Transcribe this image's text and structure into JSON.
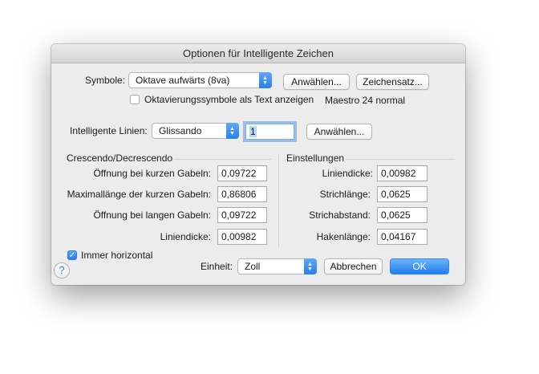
{
  "window": {
    "title": "Optionen für Intelligente Zeichen"
  },
  "symbole": {
    "label": "Symbole:",
    "selected": "Oktave aufwärts (8va)",
    "anwaehlen": "Anwählen...",
    "zeichensatz": "Zeichensatz...",
    "checkbox_label": "Oktavierungssymbole als Text anzeigen",
    "font_info": "Maestro 24 normal"
  },
  "linien": {
    "label": "Intelligente Linien:",
    "selected": "Glissando",
    "value": "1",
    "anwaehlen": "Anwählen..."
  },
  "crescendo": {
    "title": "Crescendo/Decrescendo",
    "rows": [
      {
        "label": "Öffnung bei kurzen Gabeln:",
        "value": "0,09722"
      },
      {
        "label": "Maximallänge der kurzen Gabeln:",
        "value": "0,86806"
      },
      {
        "label": "Öffnung bei langen Gabeln:",
        "value": "0,09722"
      },
      {
        "label": "Liniendicke:",
        "value": "0,00982"
      }
    ]
  },
  "einstellungen": {
    "title": "Einstellungen",
    "rows": [
      {
        "label": "Liniendicke:",
        "value": "0,00982"
      },
      {
        "label": "Strichlänge:",
        "value": "0,0625"
      },
      {
        "label": "Strichabstand:",
        "value": "0,0625"
      },
      {
        "label": "Hakenlänge:",
        "value": "0,04167"
      }
    ]
  },
  "immer_horizontal": {
    "label": "Immer horizontal",
    "checked": true
  },
  "einheit": {
    "label": "Einheit:",
    "selected": "Zoll"
  },
  "buttons": {
    "cancel": "Abbrechen",
    "ok": "OK"
  },
  "help": {
    "glyph": "?"
  }
}
